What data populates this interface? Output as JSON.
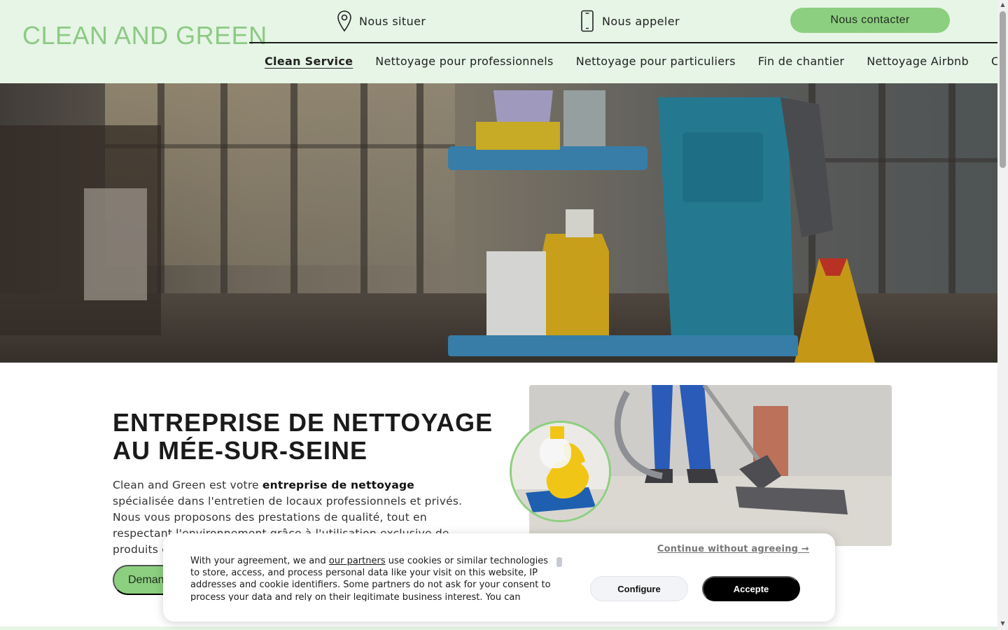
{
  "header": {
    "logo": "CLEAN AND GREEN",
    "locate_label": "Nous situer",
    "call_label": "Nous appeler",
    "contact_button": "Nous contacter",
    "icons": [
      "location-pin-icon",
      "phone-icon"
    ]
  },
  "nav": {
    "items": [
      {
        "label": "Clean Service",
        "active": true
      },
      {
        "label": "Nettoyage pour professionnels",
        "active": false
      },
      {
        "label": "Nettoyage pour particuliers",
        "active": false
      },
      {
        "label": "Fin de chantier",
        "active": false
      },
      {
        "label": "Nettoyage Airbnb",
        "active": false
      },
      {
        "label": "Contact",
        "active": false
      }
    ]
  },
  "main": {
    "title": "ENTREPRISE DE NETTOYAGE AU MÉE-SUR-SEINE",
    "intro_before": "Clean and Green est votre ",
    "intro_bold": "entreprise de nettoyage",
    "intro_after": " spécialisée dans l'entretien de locaux professionnels et privés. Nous vous proposons des prestations de qualité, tout en respectant l'environnement grâce à l'utilisation exclusive de produits écologiques.",
    "cta_label": "Demander un devis"
  },
  "cookie": {
    "continue_label": "Continue without agreeing →",
    "text_before": "With your agreement, we and ",
    "partners_link": "our partners",
    "text_after": " use cookies or similar technologies to store, access, and process personal data like your visit on this website, IP addresses and cookie identifiers. Some partners do not ask for your consent to process your data and rely on their legitimate business interest. You can",
    "configure_label": "Configure",
    "accept_label": "Accepte"
  },
  "colors": {
    "brand_green": "#8dcf80",
    "header_bg": "#e6f5e6",
    "logo_green": "#8dca84"
  }
}
